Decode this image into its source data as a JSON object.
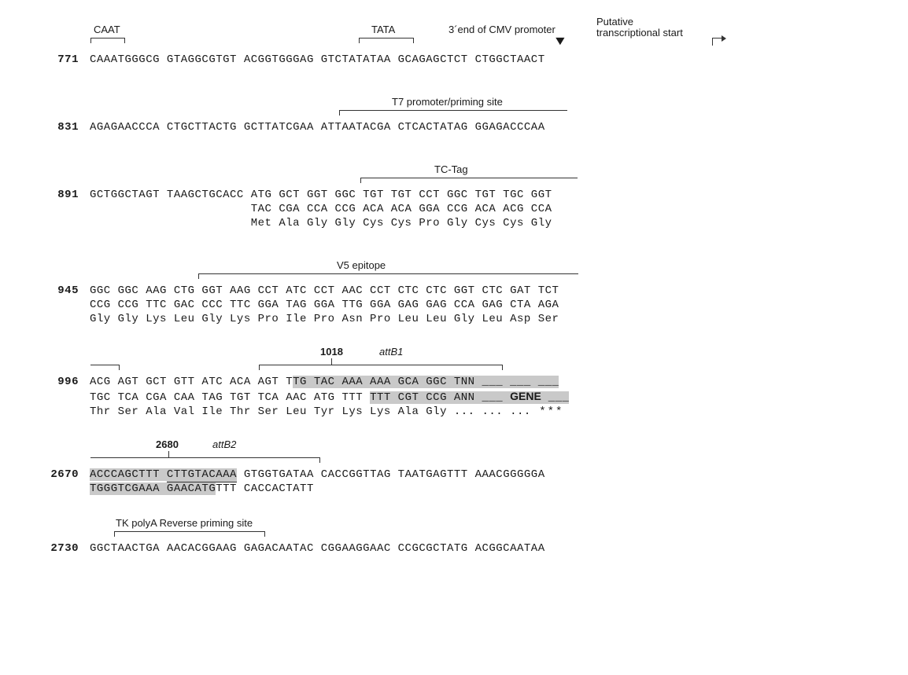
{
  "labels": {
    "caat": "CAAT",
    "tata": "TATA",
    "cmv": "3´end of CMV promoter",
    "putative1": "Putative",
    "putative2": "transcriptional start",
    "t7": "T7 promoter/priming site",
    "tctag": "TC-Tag",
    "v5": "V5 epitope",
    "attb1_bold": "1018",
    "attb1": "attB1",
    "attb2_bold": "2680",
    "attb2": "attB2",
    "tkpoly": "TK polyA Reverse priming site",
    "gene": "GENE"
  },
  "rows": {
    "r771_pos": "771",
    "r771": "CAAATGGGCG GTAGGCGTGT ACGGTGGGAG GTCTATATAA GCAGAGCTCT CTGGCTAACT",
    "r831_pos": "831",
    "r831": "AGAGAACCCA CTGCTTACTG GCTTATCGAA ATTAATACGA CTCACTATAG GGAGACCCAA",
    "r891_pos": "891",
    "r891_top": "GCTGGCTAGT TAAGCTGCACC ATG GCT GGT GGC TGT TGT CCT GGC TGT TGC GGT",
    "r891_comp": "                       TAC CGA CCA CCG ACA ACA GGA CCG ACA ACG CCA",
    "r891_aa": "                       Met Ala Gly Gly Cys Cys Pro Gly Cys Cys Gly",
    "r945_pos": "945",
    "r945_top": "GGC GGC AAG CTG GGT AAG CCT ATC CCT AAC CCT CTC CTC GGT CTC GAT TCT",
    "r945_comp": "CCG CCG TTC GAC CCC TTC GGA TAG GGA TTG GGA GAG GAG CCA GAG CTA AGA",
    "r945_aa": "Gly Gly Lys Leu Gly Lys Pro Ile Pro Asn Pro Leu Leu Gly Leu Asp Ser",
    "r996_pos": "996",
    "r996_top_a": "ACG AGT GCT GTT ATC ACA AGT T",
    "r996_top_b": "TG TAC AAA AAA GCA GGC TNN ___ ___ ___",
    "r996_comp_a": "TGC TCA CGA CAA TAG TGT TCA AAC ATG TTT ",
    "r996_comp_b": "TTT CGT CCG ANN ___",
    "r996_gene": "GENE",
    "r996_comp_c": "___",
    "r996_aa_a": "Thr Ser Ala Val Ile Thr Ser Leu Tyr Lys Lys Ala Gly ... ... ...",
    "r996_aa_b": " ***",
    "r2670_pos": "2670",
    "r2670_top_a": "ACCCAGCTTT ",
    "r2670_top_b": "CTTGTACAAA",
    "r2670_top_c": " GTGGTGATAA CACCGGTTAG TAATGAGTTT AAACGGGGGA",
    "r2670_comp_a": "TGGGTCGAAA GAACATG",
    "r2670_comp_b": "TTT CACCACTATT",
    "r2730_pos": "2730",
    "r2730": "GGCTAACTGA AACACGGAAG GAGACAATAC CGGAAGGAAC CCGCGCTATG ACGGCAATAA"
  }
}
